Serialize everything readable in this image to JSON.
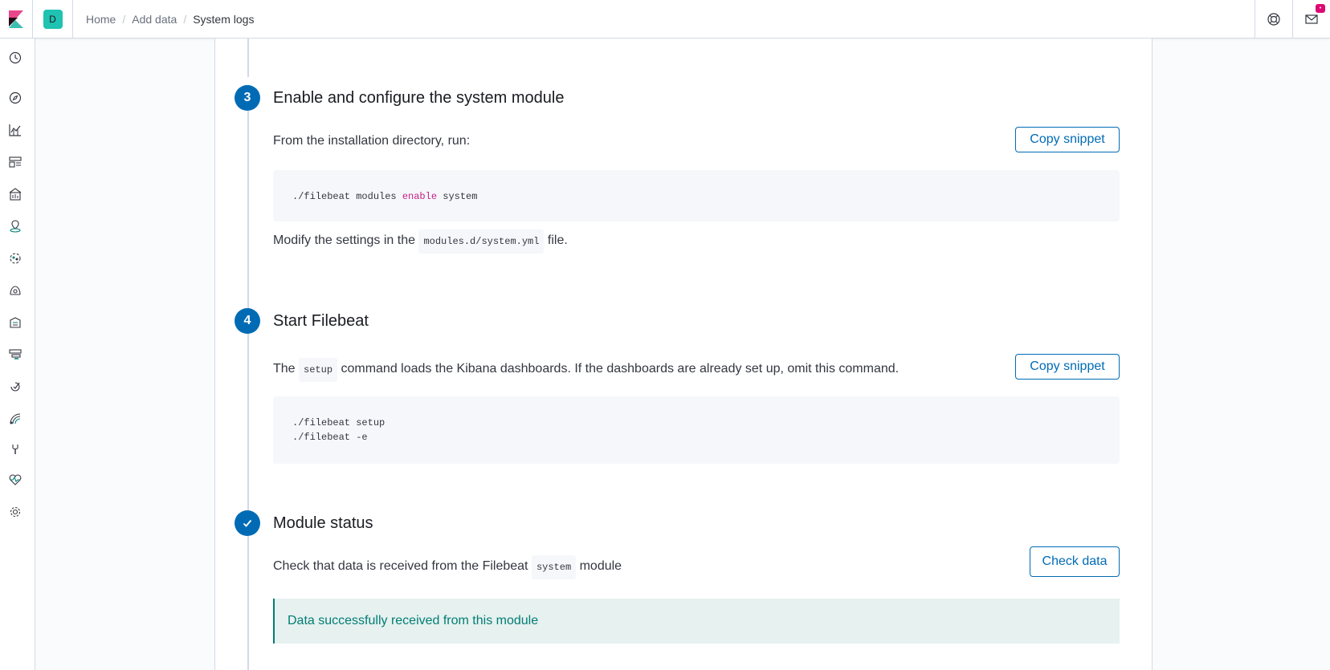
{
  "header": {
    "space_initial": "D",
    "breadcrumbs": [
      "Home",
      "Add data"
    ],
    "current": "System logs",
    "separator": "/",
    "notification_badge": "•"
  },
  "steps": {
    "step3": {
      "number": "3",
      "title": "Enable and configure the system module",
      "intro": "From the installation directory, run:",
      "copy_label": "Copy snippet",
      "code_prefix": "./filebeat modules ",
      "code_keyword": "enable",
      "code_suffix": " system",
      "modify_before": "Modify the settings in the ",
      "modify_code": "modules.d/system.yml",
      "modify_after": " file."
    },
    "step4": {
      "number": "4",
      "title": "Start Filebeat",
      "text_before": "The ",
      "text_code": "setup",
      "text_after": " command loads the Kibana dashboards. If the dashboards are already set up, omit this command.",
      "copy_label": "Copy snippet",
      "code_line1": "./filebeat setup",
      "code_line2": "./filebeat -e"
    },
    "status": {
      "title": "Module status",
      "text_before": "Check that data is received from the Filebeat ",
      "text_code": "system",
      "text_after": " module",
      "check_label": "Check data",
      "success_msg": "Data successfully received from this module"
    }
  },
  "colors": {
    "primary": "#006bb4",
    "success": "#017d73",
    "accent": "#dd0a73"
  }
}
